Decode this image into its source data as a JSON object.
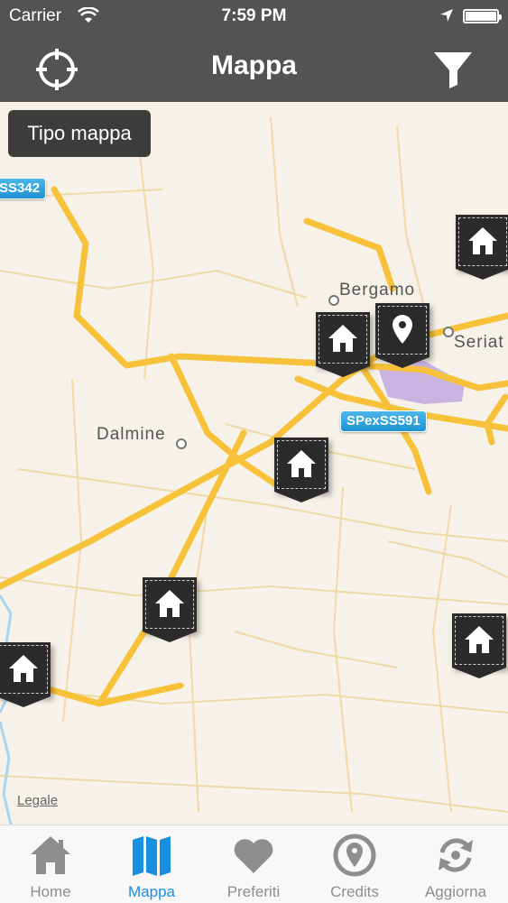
{
  "status_bar": {
    "carrier": "Carrier",
    "time": "7:59 PM",
    "battery_level": 1.0
  },
  "nav_bar": {
    "title": "Mappa",
    "left_icon": "crosshair-locate-icon",
    "right_icon": "filter-funnel-icon"
  },
  "map": {
    "map_type_button": "Tipo mappa",
    "legal_link": "Legale",
    "road_labels": [
      "SS342",
      "SPexSS591"
    ],
    "places": [
      "Bergamo",
      "Seriat",
      "Dalmine"
    ],
    "colors": {
      "background": "#f6f2e9",
      "highway": "#f7c23a",
      "minor_road": "#efd9a6",
      "water": "#a8d4f2",
      "airport": "#c9b3e0",
      "marker": "#2b2b2b"
    },
    "markers": [
      {
        "type": "home",
        "icon": "house-icon"
      },
      {
        "type": "home",
        "icon": "house-icon"
      },
      {
        "type": "location",
        "icon": "location-pin-icon"
      },
      {
        "type": "home",
        "icon": "house-icon"
      },
      {
        "type": "home",
        "icon": "house-icon"
      },
      {
        "type": "home",
        "icon": "house-icon"
      },
      {
        "type": "home",
        "icon": "house-icon"
      }
    ]
  },
  "tab_bar": {
    "active": "Mappa",
    "tabs": [
      {
        "label": "Home",
        "icon": "house-icon"
      },
      {
        "label": "Mappa",
        "icon": "map-icon"
      },
      {
        "label": "Preferiti",
        "icon": "heart-icon"
      },
      {
        "label": "Credits",
        "icon": "credits-pin-icon"
      },
      {
        "label": "Aggiorna",
        "icon": "refresh-icon"
      }
    ]
  }
}
